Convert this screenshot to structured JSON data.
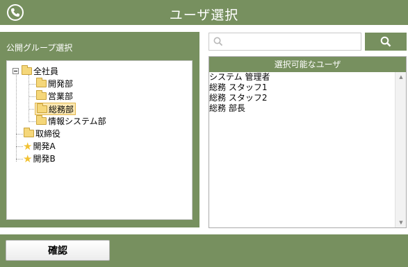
{
  "header": {
    "title": "ユーザ選択",
    "icon": "phone-icon"
  },
  "left_panel": {
    "title": "公開グループ選択",
    "tree": {
      "root": "全社員",
      "children": [
        "開発部",
        "営業部",
        "総務部",
        "情報システム部"
      ],
      "siblings": [
        "取締役"
      ],
      "favorites": [
        "開発A",
        "開発B"
      ],
      "selected": "総務部"
    }
  },
  "search": {
    "value": "",
    "placeholder": ""
  },
  "user_list": {
    "header": "選択可能なユーザ",
    "items": [
      "システム 管理者",
      "総務 スタッフ1",
      "総務 スタッフ2",
      "総務 部長"
    ]
  },
  "footer": {
    "confirm_label": "確認"
  },
  "colors": {
    "accent": "#77905f",
    "selection": "#fbe8b3"
  }
}
